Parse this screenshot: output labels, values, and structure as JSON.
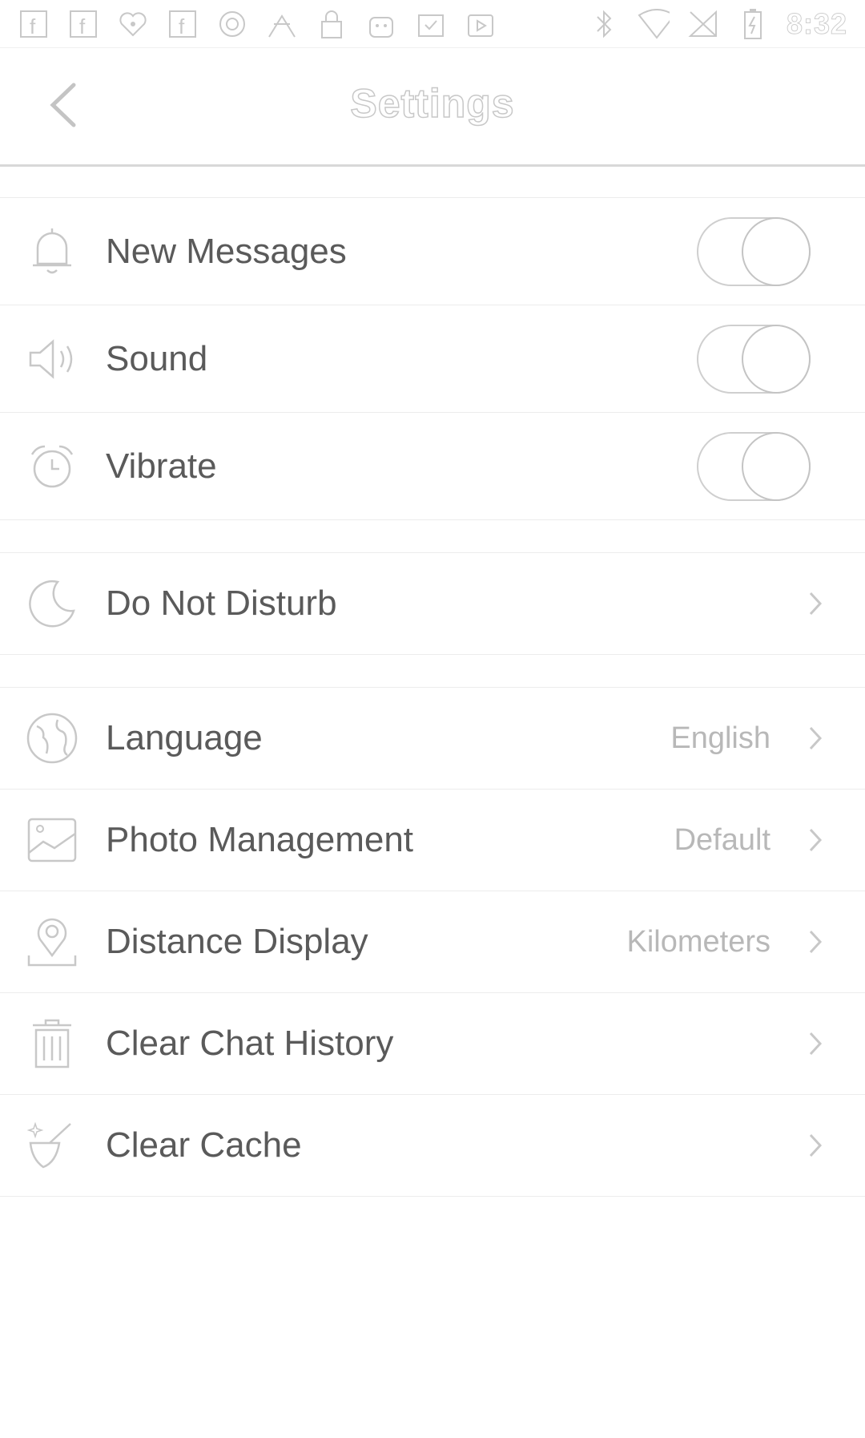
{
  "status_bar": {
    "time": "8:32",
    "left_icons": [
      "facebook-icon",
      "facebook-icon",
      "iheartradio-icon",
      "facebook-icon",
      "circle-app-icon",
      "sports-icon",
      "lock-icon",
      "android-icon",
      "clipboard-check-icon",
      "play-store-icon"
    ],
    "right_icons": [
      "bluetooth-icon",
      "wifi-icon",
      "no-sim-icon",
      "battery-charging-icon"
    ]
  },
  "header": {
    "title": "Settings"
  },
  "sections": {
    "notifications": [
      {
        "label": "New Messages",
        "icon": "bell-icon",
        "toggle_on": false
      },
      {
        "label": "Sound",
        "icon": "speaker-icon",
        "toggle_on": false
      },
      {
        "label": "Vibrate",
        "icon": "alarm-clock-icon",
        "toggle_on": false
      }
    ],
    "dnd": {
      "label": "Do Not Disturb",
      "icon": "moon-icon"
    },
    "general": [
      {
        "label": "Language",
        "value": "English",
        "icon": "globe-icon"
      },
      {
        "label": "Photo Management",
        "value": "Default",
        "icon": "photo-icon"
      },
      {
        "label": "Distance Display",
        "value": "Kilometers",
        "icon": "location-pin-icon"
      },
      {
        "label": "Clear Chat History",
        "value": "",
        "icon": "trash-icon"
      },
      {
        "label": "Clear Cache",
        "value": "",
        "icon": "broom-icon"
      }
    ]
  },
  "colors": {
    "line": "#d8d8d8",
    "text": "#5a5a5a",
    "value": "#b8b8b8",
    "icon": "#c8c8c8"
  }
}
